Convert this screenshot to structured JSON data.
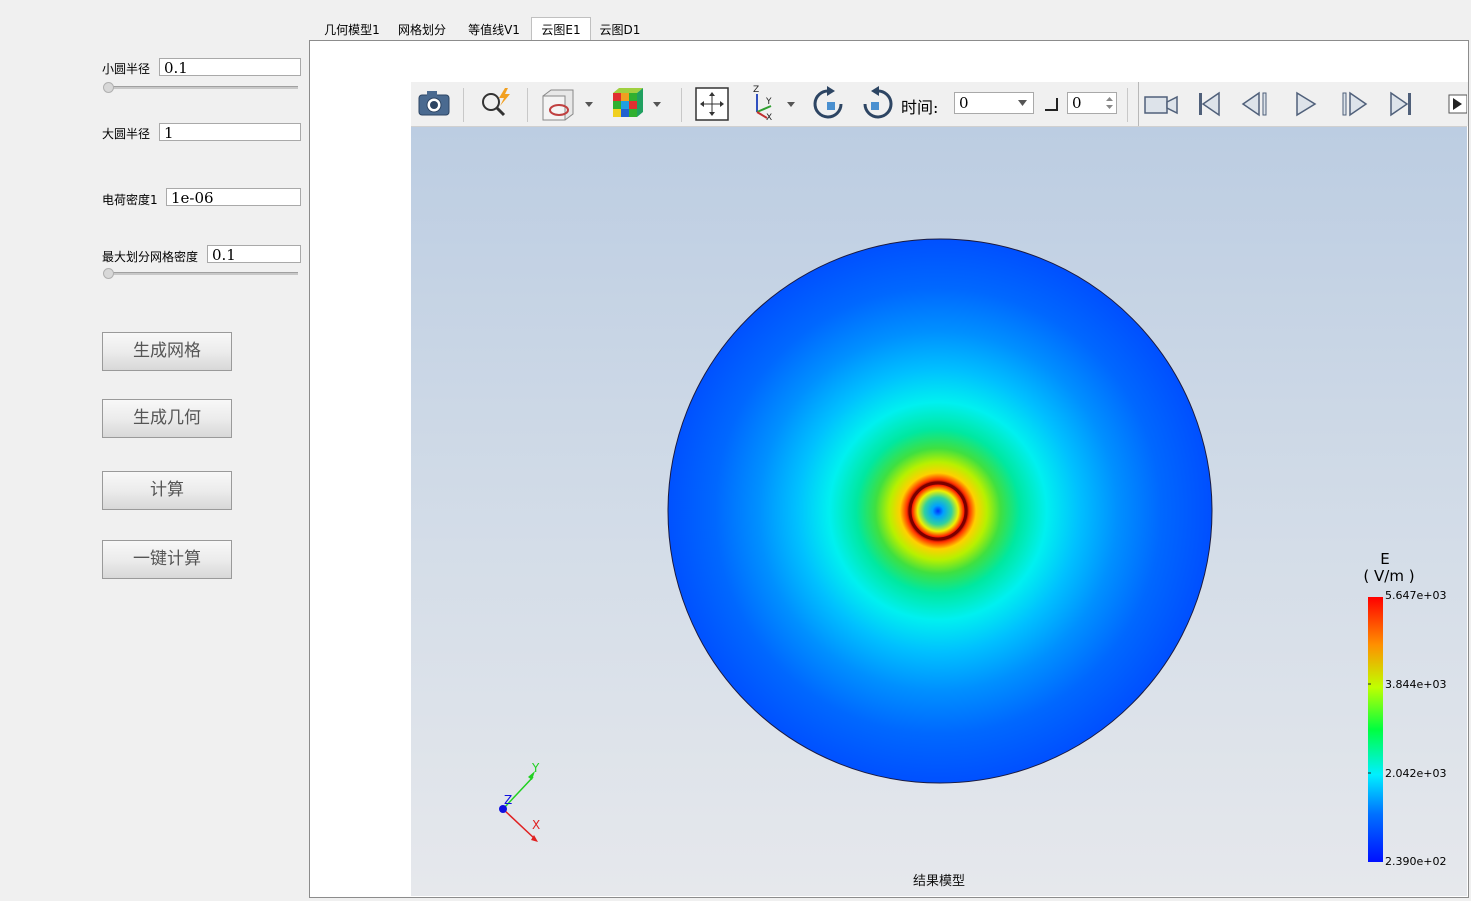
{
  "tabs": [
    {
      "label": "几何模型1"
    },
    {
      "label": "网格划分"
    },
    {
      "label": "等值线V1"
    },
    {
      "label": "云图E1"
    },
    {
      "label": "云图D1"
    }
  ],
  "active_tab": "云图E1",
  "params": {
    "small_radius": {
      "label": "小圆半径",
      "value": "0.1"
    },
    "big_radius": {
      "label": "大圆半径",
      "value": "1"
    },
    "charge_density": {
      "label": "电荷密度1",
      "value": "1e-06"
    },
    "max_mesh": {
      "label": "最大划分网格密度",
      "value": "0.1"
    }
  },
  "buttons": {
    "gen_mesh": "生成网格",
    "gen_geom": "生成几何",
    "compute": "计算",
    "one_click": "一键计算"
  },
  "toolbar": {
    "time_label": "时间:",
    "time_value": "0",
    "frame_value": "0",
    "icons": [
      "camera-icon",
      "zoom-icon",
      "cube-view-icon",
      "color-cube-icon",
      "fit-view-icon",
      "axis-orient-icon",
      "rotate-cw-icon",
      "rotate-ccw-icon",
      "record-icon",
      "first-frame-icon",
      "prev-frame-icon",
      "play-icon",
      "next-frame-icon",
      "last-frame-icon"
    ]
  },
  "viewport": {
    "caption": "结果模型",
    "legend": {
      "title": "E",
      "unit": "( V/m )",
      "ticks": [
        "5.647e+03",
        "3.844e+03",
        "2.042e+03",
        "2.390e+02"
      ]
    },
    "axes": {
      "x": "X",
      "y": "Y",
      "z": "Z"
    }
  }
}
